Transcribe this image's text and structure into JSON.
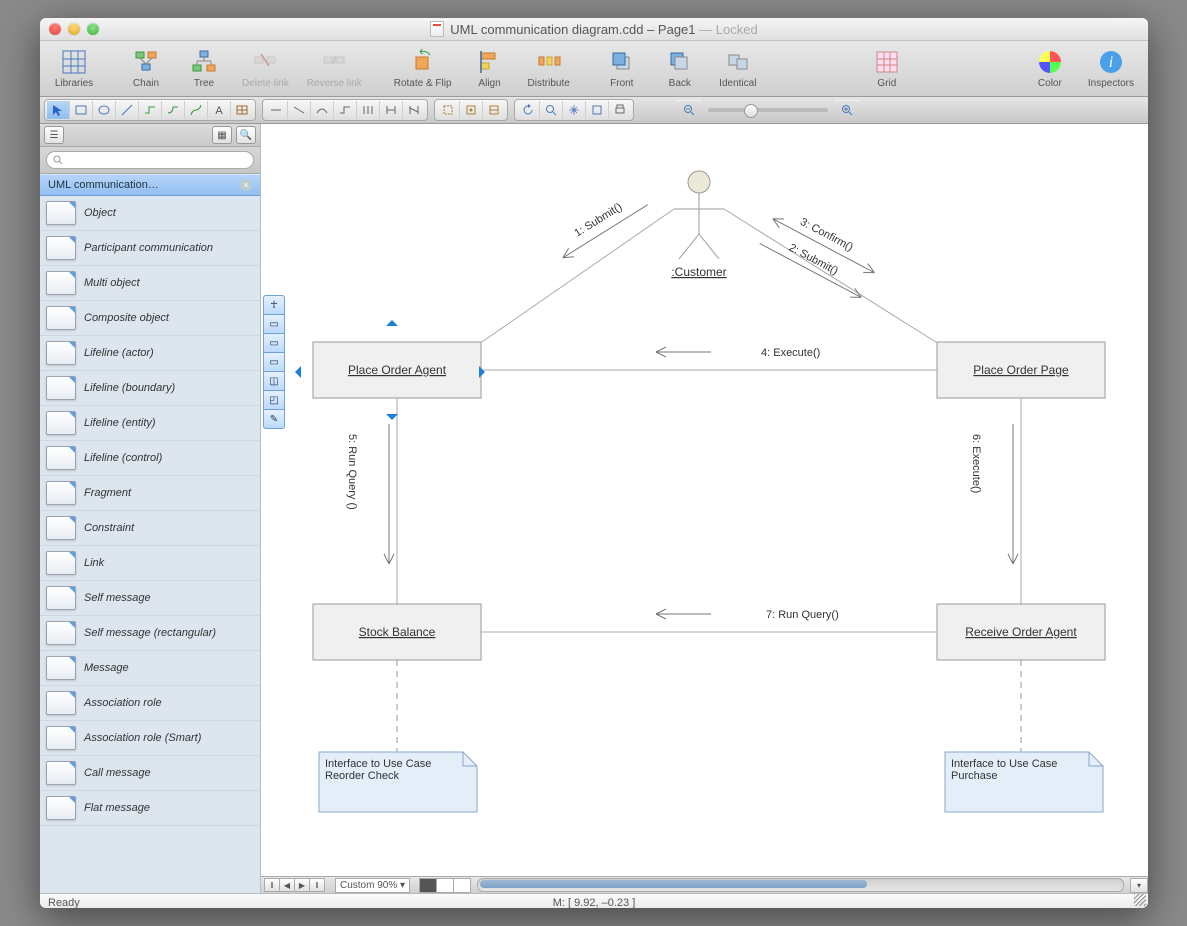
{
  "title": {
    "doc": "UML communication diagram.cdd",
    "page": "Page1",
    "locked": "Locked"
  },
  "toolbar": [
    {
      "id": "libraries",
      "label": "Libraries",
      "icon": "grid",
      "enabled": true
    },
    {
      "id": "chain",
      "label": "Chain",
      "icon": "chain",
      "enabled": true
    },
    {
      "id": "tree",
      "label": "Tree",
      "icon": "tree",
      "enabled": true
    },
    {
      "id": "delete-link",
      "label": "Delete link",
      "icon": "delete",
      "enabled": false
    },
    {
      "id": "reverse-link",
      "label": "Reverse link",
      "icon": "reverse",
      "enabled": false
    },
    {
      "id": "rotate-flip",
      "label": "Rotate & Flip",
      "icon": "rotate",
      "enabled": true
    },
    {
      "id": "align",
      "label": "Align",
      "icon": "align",
      "enabled": true
    },
    {
      "id": "distribute",
      "label": "Distribute",
      "icon": "distribute",
      "enabled": true
    },
    {
      "id": "front",
      "label": "Front",
      "icon": "front",
      "enabled": true
    },
    {
      "id": "back",
      "label": "Back",
      "icon": "back",
      "enabled": true
    },
    {
      "id": "identical",
      "label": "Identical",
      "icon": "identical",
      "enabled": true
    },
    {
      "id": "grid",
      "label": "Grid",
      "icon": "gridtool",
      "enabled": true
    },
    {
      "id": "color",
      "label": "Color",
      "icon": "color",
      "enabled": true
    },
    {
      "id": "inspectors",
      "label": "Inspectors",
      "icon": "info",
      "enabled": true
    }
  ],
  "library": {
    "title": "UML communication…",
    "search_placeholder": "",
    "shapes": [
      "Object",
      "Participant communication",
      "Multi object",
      "Composite object",
      "Lifeline (actor)",
      "Lifeline (boundary)",
      "Lifeline (entity)",
      "Lifeline (control)",
      "Fragment",
      "Constraint",
      "Link",
      "Self message",
      "Self message (rectangular)",
      "Message",
      "Association role",
      "Association role (Smart)",
      "Call message",
      "Flat message"
    ]
  },
  "diagram": {
    "actor": ":Customer",
    "boxes": {
      "place_order_agent": "Place Order Agent",
      "place_order_page": "Place Order Page",
      "stock_balance": "Stock Balance",
      "receive_order_agent": "Receive Order Agent"
    },
    "notes": {
      "reorder": "Interface to Use Case Reorder Check",
      "purchase": "Interface to Use Case Purchase"
    },
    "messages": {
      "m1": "1: Submit()",
      "m2": "2: Submit()",
      "m3": "3: Confirm()",
      "m4": "4: Execute()",
      "m5": "5: Run Query ()",
      "m6": "6: Execute()",
      "m7": "7: Run Query()"
    }
  },
  "footer": {
    "zoom": "Custom 90%  ▾"
  },
  "status": {
    "ready": "Ready",
    "mouse": "M: [ 9.92, –0.23 ]"
  }
}
